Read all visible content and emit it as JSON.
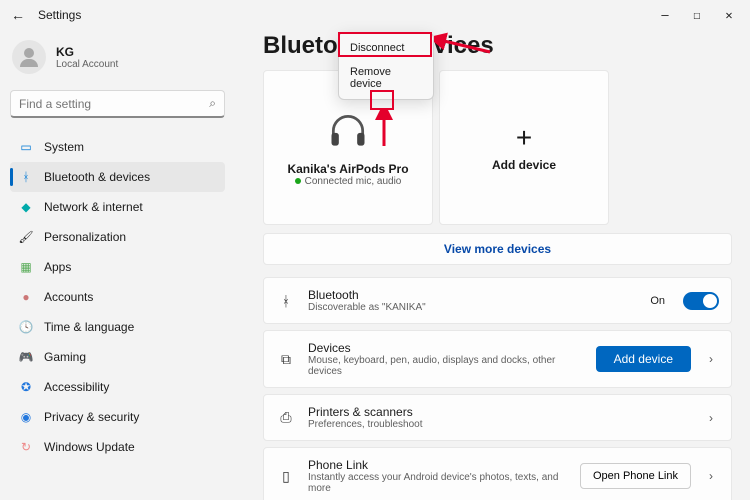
{
  "titlebar": {
    "back": "←",
    "title": "Settings"
  },
  "profile": {
    "name": "KG",
    "account": "Local Account"
  },
  "search": {
    "placeholder": "Find a setting"
  },
  "nav": [
    {
      "label": "System",
      "icon": "🖥️"
    },
    {
      "label": "Bluetooth & devices",
      "icon": "ᚼ",
      "active": true
    },
    {
      "label": "Network & internet",
      "icon": "📶"
    },
    {
      "label": "Personalization",
      "icon": "🖌️"
    },
    {
      "label": "Apps",
      "icon": "▦"
    },
    {
      "label": "Accounts",
      "icon": "👤"
    },
    {
      "label": "Time & language",
      "icon": "🕓"
    },
    {
      "label": "Gaming",
      "icon": "🎮"
    },
    {
      "label": "Accessibility",
      "icon": "⚙"
    },
    {
      "label": "Privacy & security",
      "icon": "🛡"
    },
    {
      "label": "Windows Update",
      "icon": "↻"
    }
  ],
  "page": {
    "title": "Bluetooth & devices"
  },
  "device_card": {
    "name": "Kanika's AirPods Pro",
    "status": "Connected mic, audio"
  },
  "add_card": {
    "label": "Add device"
  },
  "viewmore": "View more devices",
  "context_menu": {
    "disconnect": "Disconnect",
    "remove": "Remove device"
  },
  "rows": {
    "bluetooth": {
      "title": "Bluetooth",
      "sub": "Discoverable as \"KANIKA\"",
      "state": "On"
    },
    "devices": {
      "title": "Devices",
      "sub": "Mouse, keyboard, pen, audio, displays and docks, other devices",
      "btn": "Add device"
    },
    "printers": {
      "title": "Printers & scanners",
      "sub": "Preferences, troubleshoot"
    },
    "phone": {
      "title": "Phone Link",
      "sub": "Instantly access your Android device's photos, texts, and more",
      "btn": "Open Phone Link"
    }
  }
}
